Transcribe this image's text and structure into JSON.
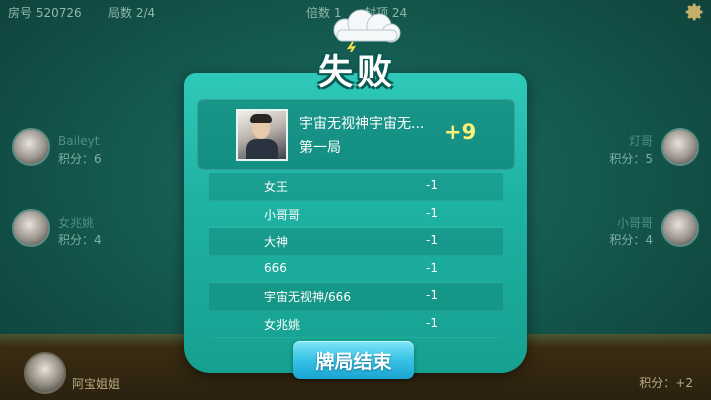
{
  "topbar": {
    "room": "房号 520726",
    "round": "局数 2/4",
    "multiplier": "倍数 1",
    "cap": "封顶 24"
  },
  "title": "失败",
  "players": {
    "left1": {
      "name": "Baileyt",
      "score": "积分：6"
    },
    "left2": {
      "name": "女兆姚",
      "score": "积分：4"
    },
    "right1": {
      "name": "灯哥",
      "score": "积分：5"
    },
    "right2": {
      "name": "小哥哥",
      "score": "积分：4"
    }
  },
  "self": {
    "name": "阿宝姐姐",
    "score": "积分：+2"
  },
  "winner": {
    "name": "宇宙无视神宇宙无...",
    "round_label": "第一局",
    "delta": "+9"
  },
  "results": [
    {
      "name": "女王",
      "value": "-1"
    },
    {
      "name": "小哥哥",
      "value": "-1"
    },
    {
      "name": "大神",
      "value": "-1"
    },
    {
      "name": "666",
      "value": "-1"
    },
    {
      "name": "宇宙无视神/666",
      "value": "-1"
    },
    {
      "name": "女兆姚",
      "value": "-1"
    }
  ],
  "end_button_label": "牌局结束",
  "icons": {
    "settings": "gear-icon",
    "title_decoration": "storm-cloud-icon"
  },
  "colors": {
    "panel": "#1fb3a4",
    "delta": "#f7f178",
    "button": "#38c2e6"
  }
}
